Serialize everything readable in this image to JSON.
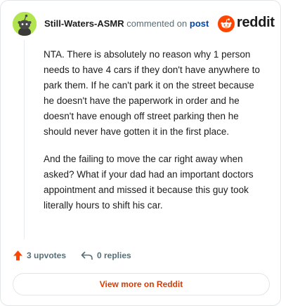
{
  "comment": {
    "username": "Still-Waters-ASMR",
    "action_text": "commented on",
    "post_link": "post",
    "paragraphs": [
      "NTA. There is absolutely no reason why 1 person needs to have 4 cars if they don't have anywhere to park them. If he can't park it on the street because he doesn't have the paperwork in order and he doesn't have enough off street parking then he should never have gotten it in the first place.",
      "And the failing to move the car right away when asked? What if your dad had an important doctors appointment and missed it because this guy took literally hours to shift his car."
    ]
  },
  "brand": {
    "name": "reddit",
    "color": "#ff4500"
  },
  "actions": {
    "upvotes": "3 upvotes",
    "replies": "0 replies"
  },
  "footer": {
    "view_more": "View more on Reddit"
  },
  "icons": {
    "avatar": "snoo-avatar-icon",
    "logo": "reddit-logo-icon",
    "upvote": "upvote-arrow-icon",
    "reply": "reply-arrow-icon"
  },
  "colors": {
    "avatar_bg": "#b2e44f",
    "upvote": "#ff4500",
    "link": "#0045ac",
    "view_more": "#d93a00"
  }
}
